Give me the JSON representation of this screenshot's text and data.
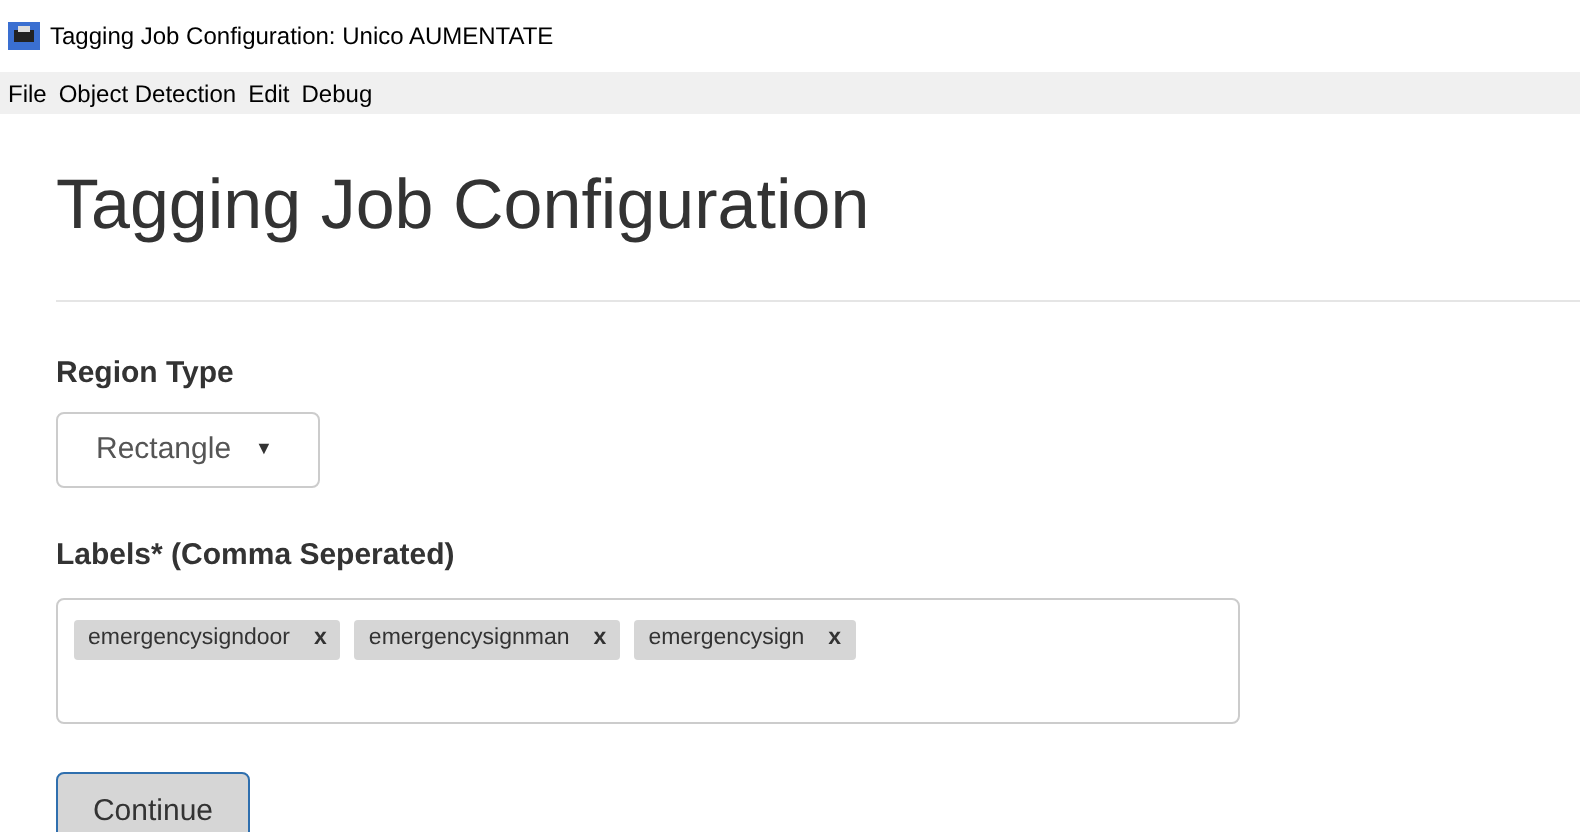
{
  "window": {
    "title": "Tagging Job Configuration: Unico AUMENTATE"
  },
  "menu": [
    "File",
    "Object Detection",
    "Edit",
    "Debug"
  ],
  "heading": "Tagging Job Configuration",
  "region_type": {
    "label": "Region Type",
    "value": "Rectangle",
    "caret": "▼"
  },
  "labels": {
    "label": "Labels* (Comma Seperated)",
    "tags": [
      {
        "text": "emergencysigndoor",
        "remove": "x"
      },
      {
        "text": "emergencysignman",
        "remove": "x"
      },
      {
        "text": "emergencysign",
        "remove": "x"
      }
    ]
  },
  "button": "Continue"
}
